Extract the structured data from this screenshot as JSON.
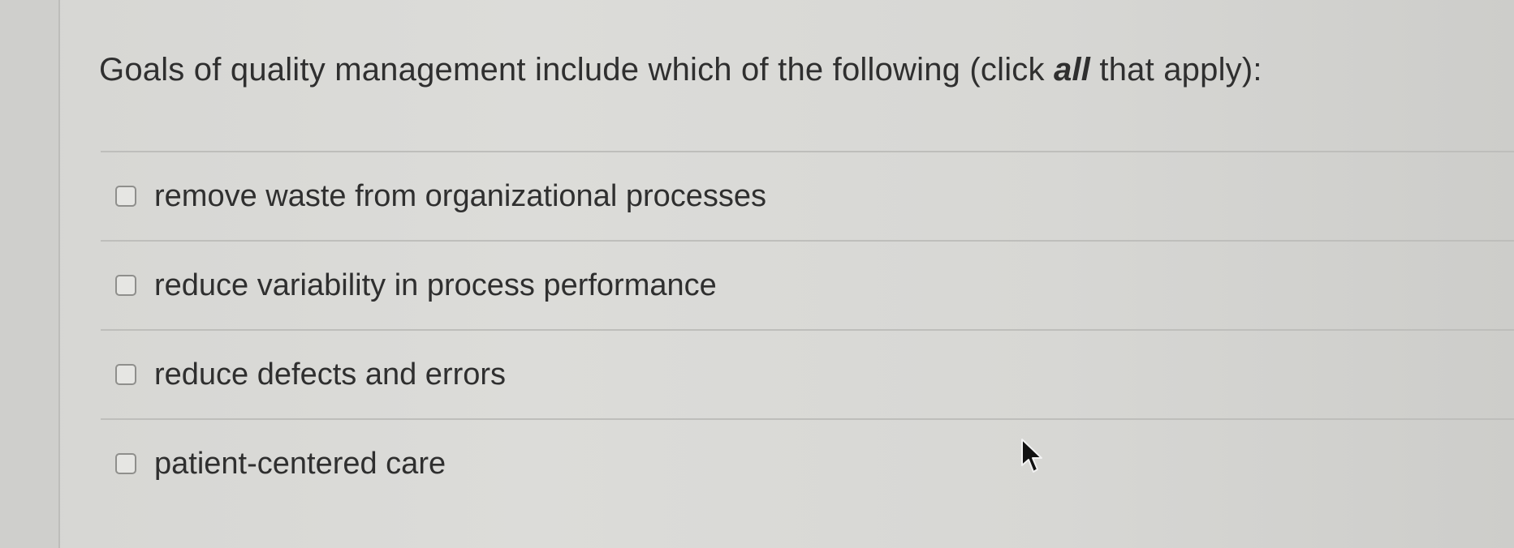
{
  "question": {
    "prefix": "Goals of quality management include which of the following (click ",
    "emphasis": "all",
    "suffix": " that apply):"
  },
  "options": [
    {
      "label": "remove waste from organizational processes",
      "checked": false
    },
    {
      "label": "reduce variability in process performance",
      "checked": false
    },
    {
      "label": "reduce defects and errors",
      "checked": false
    },
    {
      "label": "patient-centered care",
      "checked": false
    }
  ],
  "icons": {
    "checkbox": "empty-checkbox-icon",
    "cursor": "mouse-pointer-icon"
  },
  "colors": {
    "text": "#2f2f2f",
    "background": "#d8d8d5",
    "divider": "#bebebb",
    "checkbox_border": "#8f8f8c"
  }
}
